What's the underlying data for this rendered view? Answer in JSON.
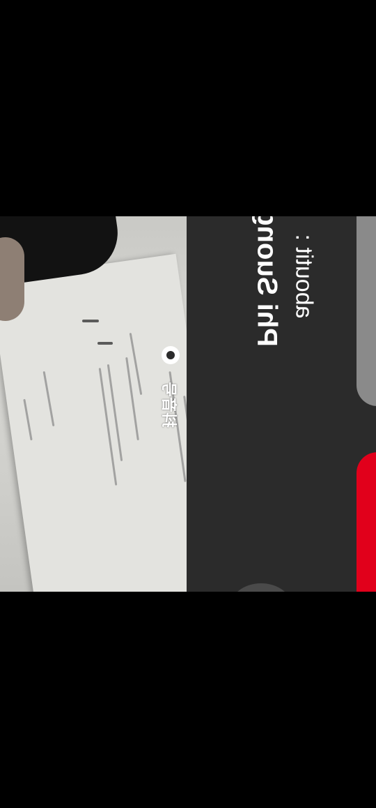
{
  "preview": {
    "watermark_text": "抖音号",
    "logo_icon": "douyin-logo-icon"
  },
  "panel": {
    "title": "Phi Suong",
    "subtitle": "aboutit :",
    "accent_color": "#e1001b",
    "card_color": "#8a8a8a",
    "background": "#2b2b2b"
  }
}
